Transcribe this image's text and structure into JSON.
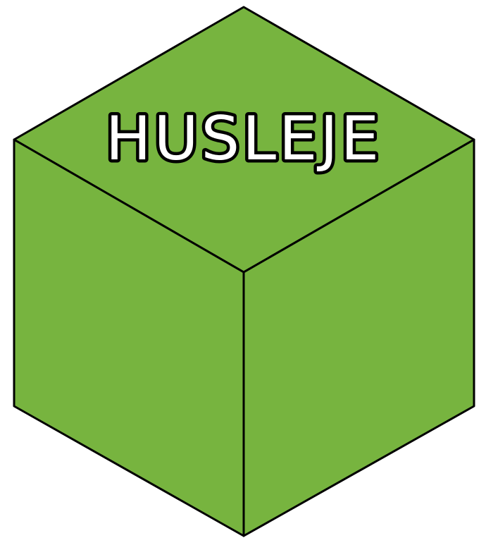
{
  "cube": {
    "label": "HUSLEJE",
    "face_color": "#77b43f",
    "edge_color": "#000000",
    "label_fill": "#ffffff",
    "label_outline": "#000000"
  }
}
